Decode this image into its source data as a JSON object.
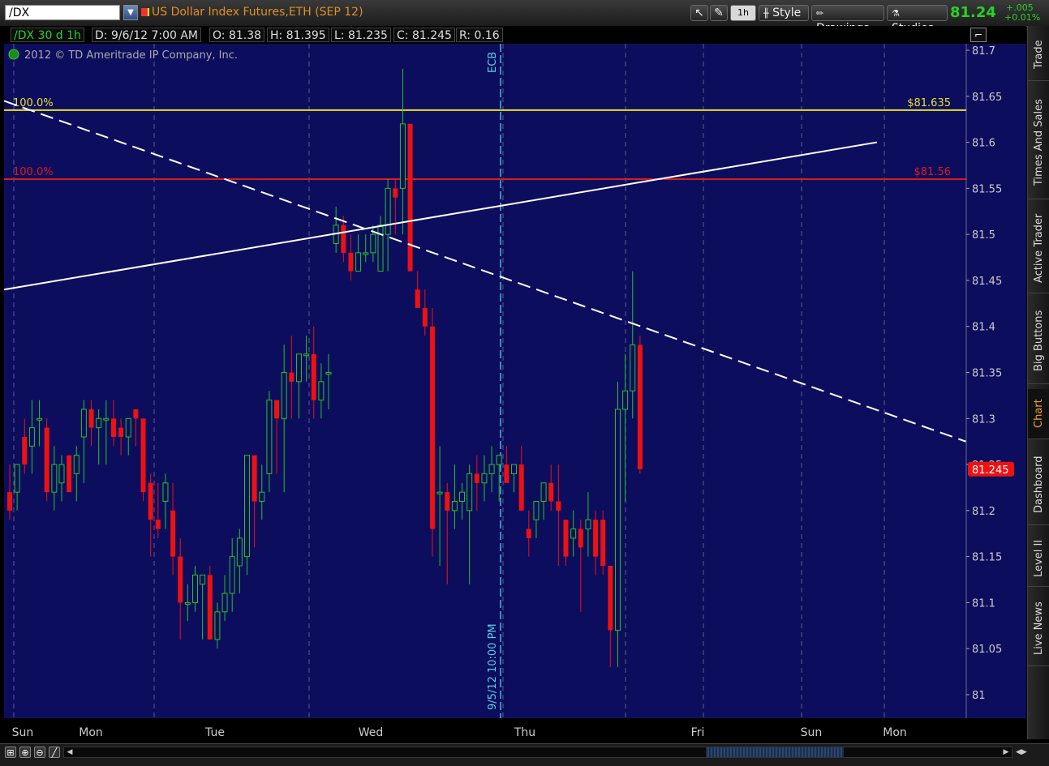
{
  "toolbar": {
    "symbol": "/DX",
    "description": "US Dollar Index Futures,ETH (SEP 12)",
    "aggregation": "1h",
    "style_label": "Style",
    "drawings_label": "Drawings",
    "studies_label": "Studies",
    "last_price": "81.24",
    "change": "+.005",
    "change_pct": "+0.01%"
  },
  "infobar": {
    "symbol_period": "/DX 30 d 1h",
    "date": "D: 9/6/12 7:00 AM",
    "open": "O: 81.38",
    "high": "H: 81.395",
    "low": "L: 81.235",
    "close": "C: 81.245",
    "range": "R: 0.16"
  },
  "copyright": "2012 © TD Ameritrade IP Company, Inc.",
  "sidepanel": {
    "tabs": [
      "Trade",
      "Times And Sales",
      "Active Trader",
      "Big Buttons",
      "Chart",
      "Dashboard",
      "Level II",
      "Live News"
    ],
    "active": "Chart"
  },
  "colors": {
    "background": "#0d0d5e",
    "up": "#22c622",
    "down": "#ee1111",
    "fib_high": "#e8e02a",
    "fib_low": "#dd1a1a",
    "event_line": "#5ad0e8",
    "trendline": "#ffffff",
    "price_tag": "#ee1111"
  },
  "chart_data": {
    "type": "candlestick",
    "y_ticks": [
      "81.7",
      "81.65",
      "81.6",
      "81.55",
      "81.5",
      "81.45",
      "81.4",
      "81.35",
      "81.3",
      "81.25",
      "81.2",
      "81.15",
      "81.1",
      "81.05",
      "81"
    ],
    "ylim": [
      81.0,
      81.7
    ],
    "x_labels": [
      "Sun",
      "Mon",
      "Tue",
      "Wed",
      "Thu",
      "Fri",
      "Sun",
      "Mon"
    ],
    "last_price_tag": "81.245",
    "levels": [
      {
        "label_left": "100.0%",
        "label_right": "$81.635",
        "value": 81.635,
        "color": "fib_high"
      },
      {
        "label_left": "100.0%",
        "label_right": "$81.56",
        "value": 81.56,
        "color": "fib_low"
      }
    ],
    "events": [
      {
        "top_label": "ECB",
        "bottom_label": "9/5/12 10:00 PM",
        "bar_index": 64
      }
    ],
    "trendlines": [
      {
        "style": "dashed",
        "from": {
          "bar": 0,
          "price": 81.645
        },
        "to": {
          "bar": 125,
          "price": 81.275
        }
      },
      {
        "style": "solid",
        "from": {
          "bar": 0,
          "price": 81.44
        },
        "to": {
          "bar": 113,
          "price": 81.6
        }
      }
    ],
    "candles": [
      {
        "o": 81.22,
        "h": 81.25,
        "l": 81.19,
        "c": 81.2
      },
      {
        "o": 81.22,
        "h": 81.25,
        "l": 81.2,
        "c": 81.25
      },
      {
        "o": 81.28,
        "h": 81.3,
        "l": 81.24,
        "c": 81.25
      },
      {
        "o": 81.27,
        "h": 81.32,
        "l": 81.24,
        "c": 81.29
      },
      {
        "o": 81.3,
        "h": 81.32,
        "l": 81.27,
        "c": 81.3
      },
      {
        "o": 81.29,
        "h": 81.3,
        "l": 81.21,
        "c": 81.22
      },
      {
        "o": 81.22,
        "h": 81.27,
        "l": 81.2,
        "c": 81.25
      },
      {
        "o": 81.23,
        "h": 81.26,
        "l": 81.21,
        "c": 81.25
      },
      {
        "o": 81.26,
        "h": 81.26,
        "l": 81.22,
        "c": 81.22
      },
      {
        "o": 81.24,
        "h": 81.27,
        "l": 81.21,
        "c": 81.26
      },
      {
        "o": 81.28,
        "h": 81.32,
        "l": 81.23,
        "c": 81.31
      },
      {
        "o": 81.31,
        "h": 81.32,
        "l": 81.27,
        "c": 81.29
      },
      {
        "o": 81.29,
        "h": 81.31,
        "l": 81.25,
        "c": 81.3
      },
      {
        "o": 81.3,
        "h": 81.32,
        "l": 81.25,
        "c": 81.3
      },
      {
        "o": 81.3,
        "h": 81.32,
        "l": 81.27,
        "c": 81.28
      },
      {
        "o": 81.29,
        "h": 81.3,
        "l": 81.26,
        "c": 81.28
      },
      {
        "o": 81.28,
        "h": 81.3,
        "l": 81.26,
        "c": 81.3
      },
      {
        "o": 81.31,
        "h": 81.31,
        "l": 81.27,
        "c": 81.3
      },
      {
        "o": 81.3,
        "h": 81.3,
        "l": 81.21,
        "c": 81.22
      },
      {
        "o": 81.23,
        "h": 81.24,
        "l": 81.15,
        "c": 81.19
      },
      {
        "o": 81.19,
        "h": 81.23,
        "l": 81.17,
        "c": 81.18
      },
      {
        "o": 81.21,
        "h": 81.24,
        "l": 81.18,
        "c": 81.23
      },
      {
        "o": 81.2,
        "h": 81.23,
        "l": 81.13,
        "c": 81.15
      },
      {
        "o": 81.15,
        "h": 81.17,
        "l": 81.06,
        "c": 81.1
      },
      {
        "o": 81.1,
        "h": 81.12,
        "l": 81.08,
        "c": 81.1
      },
      {
        "o": 81.1,
        "h": 81.14,
        "l": 81.09,
        "c": 81.13
      },
      {
        "o": 81.12,
        "h": 81.13,
        "l": 81.06,
        "c": 81.13
      },
      {
        "o": 81.13,
        "h": 81.14,
        "l": 81.06,
        "c": 81.06
      },
      {
        "o": 81.06,
        "h": 81.1,
        "l": 81.05,
        "c": 81.09
      },
      {
        "o": 81.09,
        "h": 81.13,
        "l": 81.08,
        "c": 81.11
      },
      {
        "o": 81.11,
        "h": 81.17,
        "l": 81.09,
        "c": 81.15
      },
      {
        "o": 81.14,
        "h": 81.18,
        "l": 81.11,
        "c": 81.17
      },
      {
        "o": 81.15,
        "h": 81.2,
        "l": 81.13,
        "c": 81.26
      },
      {
        "o": 81.26,
        "h": 81.26,
        "l": 81.16,
        "c": 81.21
      },
      {
        "o": 81.21,
        "h": 81.25,
        "l": 81.19,
        "c": 81.22
      },
      {
        "o": 81.24,
        "h": 81.33,
        "l": 81.22,
        "c": 81.32
      },
      {
        "o": 81.32,
        "h": 81.32,
        "l": 81.24,
        "c": 81.3
      },
      {
        "o": 81.3,
        "h": 81.38,
        "l": 81.22,
        "c": 81.35
      },
      {
        "o": 81.35,
        "h": 81.39,
        "l": 81.3,
        "c": 81.34
      },
      {
        "o": 81.34,
        "h": 81.37,
        "l": 81.3,
        "c": 81.37
      },
      {
        "o": 81.37,
        "h": 81.39,
        "l": 81.34,
        "c": 81.37
      },
      {
        "o": 81.37,
        "h": 81.4,
        "l": 81.3,
        "c": 81.32
      },
      {
        "o": 81.32,
        "h": 81.36,
        "l": 81.3,
        "c": 81.34
      },
      {
        "o": 81.35,
        "h": 81.37,
        "l": 81.31,
        "c": 81.35
      },
      {
        "o": 81.49,
        "h": 81.53,
        "l": 81.48,
        "c": 81.51
      },
      {
        "o": 81.51,
        "h": 81.52,
        "l": 81.47,
        "c": 81.48
      },
      {
        "o": 81.48,
        "h": 81.5,
        "l": 81.45,
        "c": 81.46
      },
      {
        "o": 81.46,
        "h": 81.5,
        "l": 81.46,
        "c": 81.48
      },
      {
        "o": 81.48,
        "h": 81.5,
        "l": 81.47,
        "c": 81.48
      },
      {
        "o": 81.48,
        "h": 81.51,
        "l": 81.47,
        "c": 81.5
      },
      {
        "o": 81.46,
        "h": 81.52,
        "l": 81.46,
        "c": 81.51
      },
      {
        "o": 81.5,
        "h": 81.56,
        "l": 81.46,
        "c": 81.55
      },
      {
        "o": 81.55,
        "h": 81.56,
        "l": 81.5,
        "c": 81.54
      },
      {
        "o": 81.55,
        "h": 81.68,
        "l": 81.5,
        "c": 81.62
      },
      {
        "o": 81.62,
        "h": 81.62,
        "l": 81.46,
        "c": 81.46
      },
      {
        "o": 81.44,
        "h": 81.46,
        "l": 81.42,
        "c": 81.42
      },
      {
        "o": 81.42,
        "h": 81.44,
        "l": 81.39,
        "c": 81.4
      },
      {
        "o": 81.4,
        "h": 81.42,
        "l": 81.15,
        "c": 81.18
      },
      {
        "o": 81.22,
        "h": 81.27,
        "l": 81.14,
        "c": 81.22
      },
      {
        "o": 81.22,
        "h": 81.23,
        "l": 81.12,
        "c": 81.2
      },
      {
        "o": 81.2,
        "h": 81.25,
        "l": 81.18,
        "c": 81.21
      },
      {
        "o": 81.21,
        "h": 81.23,
        "l": 81.19,
        "c": 81.22
      },
      {
        "o": 81.2,
        "h": 81.25,
        "l": 81.12,
        "c": 81.24
      },
      {
        "o": 81.24,
        "h": 81.26,
        "l": 81.2,
        "c": 81.23
      },
      {
        "o": 81.23,
        "h": 81.26,
        "l": 81.21,
        "c": 81.24
      },
      {
        "o": 81.24,
        "h": 81.27,
        "l": 81.22,
        "c": 81.25
      },
      {
        "o": 81.25,
        "h": 81.26,
        "l": 81.21,
        "c": 81.26
      },
      {
        "o": 81.25,
        "h": 81.27,
        "l": 81.23,
        "c": 81.23
      },
      {
        "o": 81.24,
        "h": 81.25,
        "l": 81.22,
        "c": 81.25
      },
      {
        "o": 81.25,
        "h": 81.27,
        "l": 81.2,
        "c": 81.2
      },
      {
        "o": 81.18,
        "h": 81.2,
        "l": 81.15,
        "c": 81.17
      },
      {
        "o": 81.19,
        "h": 81.21,
        "l": 81.17,
        "c": 81.21
      },
      {
        "o": 81.21,
        "h": 81.23,
        "l": 81.19,
        "c": 81.23
      },
      {
        "o": 81.23,
        "h": 81.25,
        "l": 81.2,
        "c": 81.21
      },
      {
        "o": 81.21,
        "h": 81.25,
        "l": 81.14,
        "c": 81.2
      },
      {
        "o": 81.19,
        "h": 81.19,
        "l": 81.14,
        "c": 81.15
      },
      {
        "o": 81.17,
        "h": 81.2,
        "l": 81.15,
        "c": 81.18
      },
      {
        "o": 81.18,
        "h": 81.19,
        "l": 81.09,
        "c": 81.16
      },
      {
        "o": 81.18,
        "h": 81.22,
        "l": 81.15,
        "c": 81.19
      },
      {
        "o": 81.19,
        "h": 81.2,
        "l": 81.13,
        "c": 81.15
      },
      {
        "o": 81.19,
        "h": 81.2,
        "l": 81.13,
        "c": 81.14
      },
      {
        "o": 81.14,
        "h": 81.14,
        "l": 81.03,
        "c": 81.07
      },
      {
        "o": 81.07,
        "h": 81.34,
        "l": 81.03,
        "c": 81.31
      },
      {
        "o": 81.31,
        "h": 81.37,
        "l": 81.21,
        "c": 81.33
      },
      {
        "o": 81.33,
        "h": 81.46,
        "l": 81.3,
        "c": 81.38
      },
      {
        "o": 81.38,
        "h": 81.39,
        "l": 81.24,
        "c": 81.245
      }
    ]
  }
}
